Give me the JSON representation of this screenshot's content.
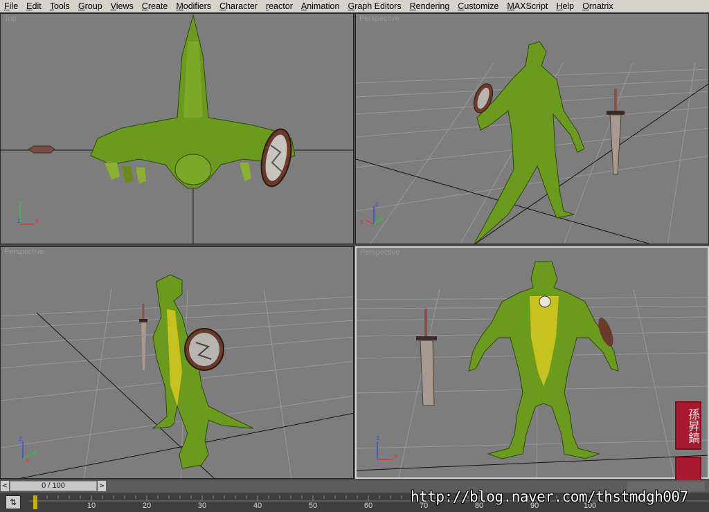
{
  "menu": [
    "File",
    "Edit",
    "Tools",
    "Group",
    "Views",
    "Create",
    "Modifiers",
    "Character",
    "reactor",
    "Animation",
    "Graph Editors",
    "Rendering",
    "Customize",
    "MAXScript",
    "Help",
    "Ornatrix"
  ],
  "viewports": {
    "top_left": {
      "label": "Top"
    },
    "top_right": {
      "label": "Perspective"
    },
    "bottom_left": {
      "label": "Perspective"
    },
    "bottom_right": {
      "label": "Perspective"
    }
  },
  "axes": {
    "x": "x",
    "y": "y",
    "z": "z"
  },
  "timeline": {
    "frame_display": "0 / 100",
    "prev_label": "<",
    "next_label": ">"
  },
  "trackbar": {
    "ticks": [
      "10",
      "20",
      "30",
      "40",
      "50",
      "60",
      "70",
      "80",
      "90",
      "100"
    ],
    "key_icon": "key-mode-icon"
  },
  "watermark": {
    "text": "http://blog.naver.com/thstmdgh007"
  },
  "seal": {
    "text": "孫昇鎬"
  },
  "colors": {
    "viewport_bg": "#7d7d7d",
    "menu_bg": "#d6d3ce",
    "lizard_green": "#6a9a1e",
    "belly_yellow": "#c8c21e"
  }
}
